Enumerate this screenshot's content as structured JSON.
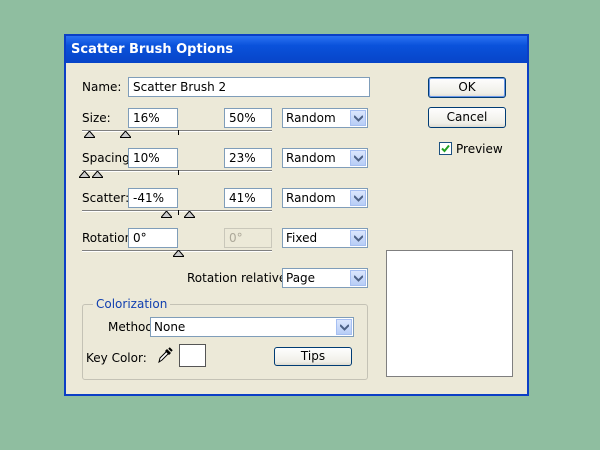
{
  "dialog": {
    "title": "Scatter Brush Options",
    "buttons": {
      "ok": "OK",
      "cancel": "Cancel"
    },
    "preview": {
      "label": "Preview",
      "checked": true
    }
  },
  "name": {
    "label": "Name:",
    "value": "Scatter Brush 2"
  },
  "size": {
    "label": "Size:",
    "min": "16%",
    "max": "50%",
    "mode": "Random"
  },
  "spacing": {
    "label": "Spacing:",
    "min": "10%",
    "max": "23%",
    "mode": "Random"
  },
  "scatter": {
    "label": "Scatter:",
    "min": "-41%",
    "max": "41%",
    "mode": "Random"
  },
  "rotation": {
    "label": "Rotation:",
    "min": "0°",
    "max": "0°",
    "mode": "Fixed"
  },
  "rotation_relative": {
    "label": "Rotation relative to:",
    "value": "Page"
  },
  "colorization": {
    "group_title": "Colorization",
    "method_label": "Method:",
    "method_value": "None",
    "key_color_label": "Key Color:",
    "tips": "Tips"
  },
  "colors": {
    "title_bar": "#0a52db",
    "dialog_bg": "#ece9d8",
    "desktop": "#8fbea0"
  }
}
